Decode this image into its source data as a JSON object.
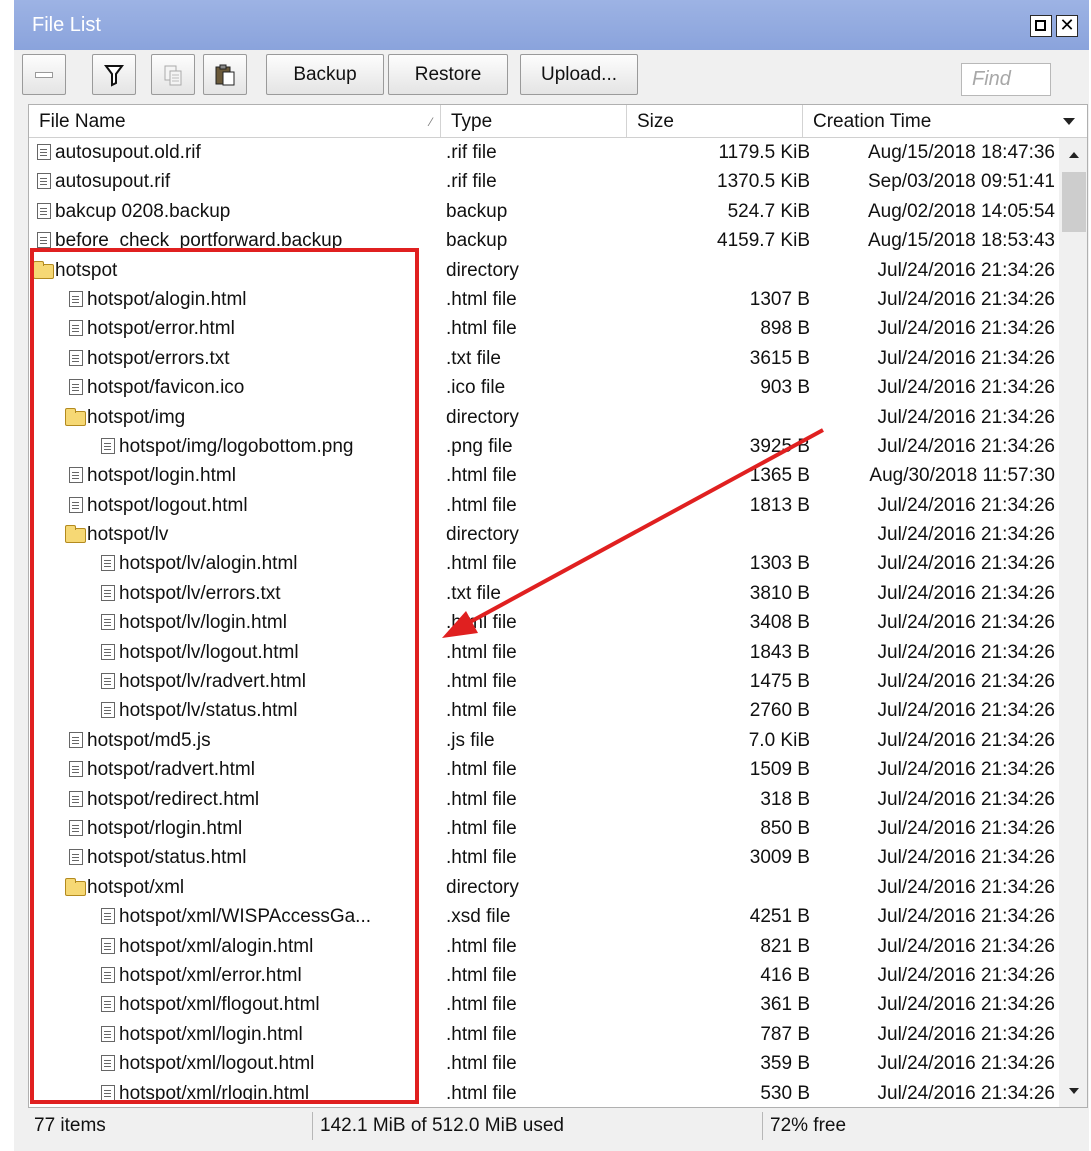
{
  "window": {
    "title": "File List"
  },
  "toolbar": {
    "backup_label": "Backup",
    "restore_label": "Restore",
    "upload_label": "Upload...",
    "find_placeholder": "Find"
  },
  "columns": {
    "name": "File Name",
    "type": "Type",
    "size": "Size",
    "time": "Creation Time"
  },
  "rows": [
    {
      "name": "autosupout.old.rif",
      "type": ".rif file",
      "size": "1179.5 KiB",
      "time": "Aug/15/2018 18:47:36",
      "icon": "file-icon",
      "depth": 0
    },
    {
      "name": "autosupout.rif",
      "type": ".rif file",
      "size": "1370.5 KiB",
      "time": "Sep/03/2018 09:51:41",
      "icon": "file-icon",
      "depth": 0
    },
    {
      "name": "bakcup 0208.backup",
      "type": "backup",
      "size": "524.7 KiB",
      "time": "Aug/02/2018 14:05:54",
      "icon": "file-icon",
      "depth": 0
    },
    {
      "name": "before_check_portforward.backup",
      "type": "backup",
      "size": "4159.7 KiB",
      "time": "Aug/15/2018 18:53:43",
      "icon": "file-icon",
      "depth": 0
    },
    {
      "name": "hotspot",
      "type": "directory",
      "size": "",
      "time": "Jul/24/2016 21:34:26",
      "icon": "folder-icon",
      "depth": 0
    },
    {
      "name": "hotspot/alogin.html",
      "type": ".html file",
      "size": "1307 B",
      "time": "Jul/24/2016 21:34:26",
      "icon": "file-icon",
      "depth": 1
    },
    {
      "name": "hotspot/error.html",
      "type": ".html file",
      "size": "898 B",
      "time": "Jul/24/2016 21:34:26",
      "icon": "file-icon",
      "depth": 1
    },
    {
      "name": "hotspot/errors.txt",
      "type": ".txt file",
      "size": "3615 B",
      "time": "Jul/24/2016 21:34:26",
      "icon": "file-icon",
      "depth": 1
    },
    {
      "name": "hotspot/favicon.ico",
      "type": ".ico file",
      "size": "903 B",
      "time": "Jul/24/2016 21:34:26",
      "icon": "file-icon",
      "depth": 1
    },
    {
      "name": "hotspot/img",
      "type": "directory",
      "size": "",
      "time": "Jul/24/2016 21:34:26",
      "icon": "folder-icon",
      "depth": 1
    },
    {
      "name": "hotspot/img/logobottom.png",
      "type": ".png file",
      "size": "3925 B",
      "time": "Jul/24/2016 21:34:26",
      "icon": "file-icon",
      "depth": 2
    },
    {
      "name": "hotspot/login.html",
      "type": ".html file",
      "size": "1365 B",
      "time": "Aug/30/2018 11:57:30",
      "icon": "file-icon",
      "depth": 1
    },
    {
      "name": "hotspot/logout.html",
      "type": ".html file",
      "size": "1813 B",
      "time": "Jul/24/2016 21:34:26",
      "icon": "file-icon",
      "depth": 1
    },
    {
      "name": "hotspot/lv",
      "type": "directory",
      "size": "",
      "time": "Jul/24/2016 21:34:26",
      "icon": "folder-icon",
      "depth": 1
    },
    {
      "name": "hotspot/lv/alogin.html",
      "type": ".html file",
      "size": "1303 B",
      "time": "Jul/24/2016 21:34:26",
      "icon": "file-icon",
      "depth": 2
    },
    {
      "name": "hotspot/lv/errors.txt",
      "type": ".txt file",
      "size": "3810 B",
      "time": "Jul/24/2016 21:34:26",
      "icon": "file-icon",
      "depth": 2
    },
    {
      "name": "hotspot/lv/login.html",
      "type": ".html file",
      "size": "3408 B",
      "time": "Jul/24/2016 21:34:26",
      "icon": "file-icon",
      "depth": 2
    },
    {
      "name": "hotspot/lv/logout.html",
      "type": ".html file",
      "size": "1843 B",
      "time": "Jul/24/2016 21:34:26",
      "icon": "file-icon",
      "depth": 2
    },
    {
      "name": "hotspot/lv/radvert.html",
      "type": ".html file",
      "size": "1475 B",
      "time": "Jul/24/2016 21:34:26",
      "icon": "file-icon",
      "depth": 2
    },
    {
      "name": "hotspot/lv/status.html",
      "type": ".html file",
      "size": "2760 B",
      "time": "Jul/24/2016 21:34:26",
      "icon": "file-icon",
      "depth": 2
    },
    {
      "name": "hotspot/md5.js",
      "type": ".js file",
      "size": "7.0 KiB",
      "time": "Jul/24/2016 21:34:26",
      "icon": "file-icon",
      "depth": 1
    },
    {
      "name": "hotspot/radvert.html",
      "type": ".html file",
      "size": "1509 B",
      "time": "Jul/24/2016 21:34:26",
      "icon": "file-icon",
      "depth": 1
    },
    {
      "name": "hotspot/redirect.html",
      "type": ".html file",
      "size": "318 B",
      "time": "Jul/24/2016 21:34:26",
      "icon": "file-icon",
      "depth": 1
    },
    {
      "name": "hotspot/rlogin.html",
      "type": ".html file",
      "size": "850 B",
      "time": "Jul/24/2016 21:34:26",
      "icon": "file-icon",
      "depth": 1
    },
    {
      "name": "hotspot/status.html",
      "type": ".html file",
      "size": "3009 B",
      "time": "Jul/24/2016 21:34:26",
      "icon": "file-icon",
      "depth": 1
    },
    {
      "name": "hotspot/xml",
      "type": "directory",
      "size": "",
      "time": "Jul/24/2016 21:34:26",
      "icon": "folder-icon",
      "depth": 1
    },
    {
      "name": "hotspot/xml/WISPAccessGa...",
      "type": ".xsd file",
      "size": "4251 B",
      "time": "Jul/24/2016 21:34:26",
      "icon": "file-icon",
      "depth": 2
    },
    {
      "name": "hotspot/xml/alogin.html",
      "type": ".html file",
      "size": "821 B",
      "time": "Jul/24/2016 21:34:26",
      "icon": "file-icon",
      "depth": 2
    },
    {
      "name": "hotspot/xml/error.html",
      "type": ".html file",
      "size": "416 B",
      "time": "Jul/24/2016 21:34:26",
      "icon": "file-icon",
      "depth": 2
    },
    {
      "name": "hotspot/xml/flogout.html",
      "type": ".html file",
      "size": "361 B",
      "time": "Jul/24/2016 21:34:26",
      "icon": "file-icon",
      "depth": 2
    },
    {
      "name": "hotspot/xml/login.html",
      "type": ".html file",
      "size": "787 B",
      "time": "Jul/24/2016 21:34:26",
      "icon": "file-icon",
      "depth": 2
    },
    {
      "name": "hotspot/xml/logout.html",
      "type": ".html file",
      "size": "359 B",
      "time": "Jul/24/2016 21:34:26",
      "icon": "file-icon",
      "depth": 2
    },
    {
      "name": "hotspot/xml/rlogin.html",
      "type": ".html file",
      "size": "530 B",
      "time": "Jul/24/2016 21:34:26",
      "icon": "file-icon",
      "depth": 2
    }
  ],
  "status": {
    "items": "77 items",
    "usage": "142.1 MiB of 512.0 MiB used",
    "free": "72% free"
  },
  "colors": {
    "titlebar": "#8ea6dd",
    "annotation": "#e02020",
    "folder": "#f6d874"
  }
}
